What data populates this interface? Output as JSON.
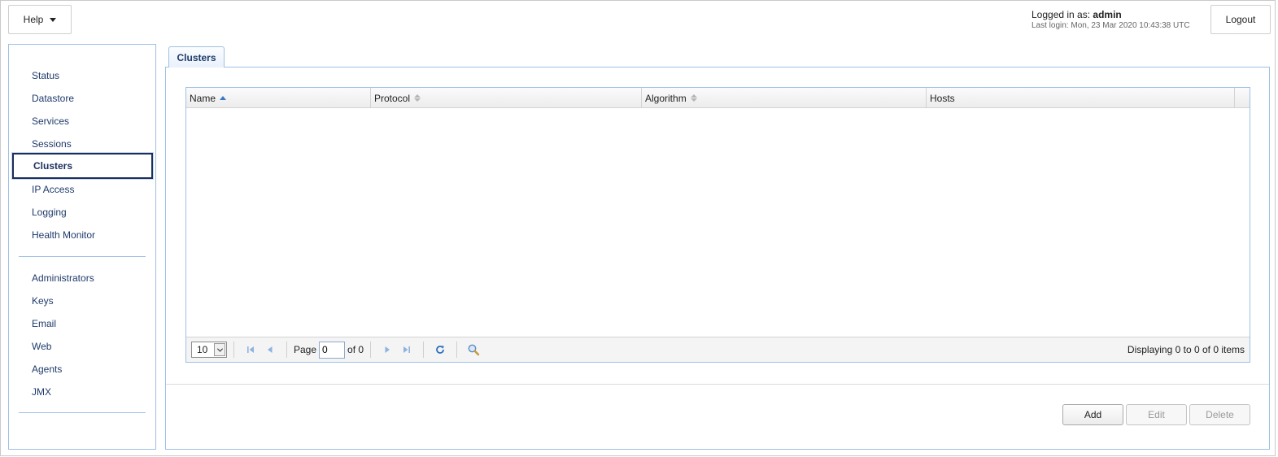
{
  "header": {
    "help_label": "Help",
    "logged_in_prefix": "Logged in as:",
    "username": "admin",
    "last_login": "Last login: Mon, 23 Mar 2020 10:43:38 UTC",
    "logout_label": "Logout"
  },
  "sidebar": {
    "group1": [
      {
        "label": "Status"
      },
      {
        "label": "Datastore"
      },
      {
        "label": "Services"
      },
      {
        "label": "Sessions"
      },
      {
        "label": "Clusters",
        "active": true
      },
      {
        "label": "IP Access"
      },
      {
        "label": "Logging"
      },
      {
        "label": "Health Monitor"
      }
    ],
    "group2": [
      {
        "label": "Administrators"
      },
      {
        "label": "Keys"
      },
      {
        "label": "Email"
      },
      {
        "label": "Web"
      },
      {
        "label": "Agents"
      },
      {
        "label": "JMX"
      }
    ]
  },
  "main": {
    "tab_label": "Clusters",
    "table": {
      "columns": [
        {
          "label": "Name",
          "sort": "asc"
        },
        {
          "label": "Protocol",
          "sort": "none"
        },
        {
          "label": "Algorithm",
          "sort": "none"
        },
        {
          "label": "Hosts",
          "sort": ""
        }
      ],
      "rows": []
    },
    "pager": {
      "page_size": "10",
      "page_label": "Page",
      "page_value": "0",
      "of_label": "of 0",
      "displaying": "Displaying 0 to 0 of 0 items"
    },
    "actions": {
      "add": "Add",
      "edit": "Edit",
      "delete": "Delete"
    }
  },
  "colors": {
    "accent_border": "#9ec0e6",
    "nav_text": "#1f3b6b",
    "active_border": "#1b2f5e",
    "pager_icon": "#8fb3e0"
  }
}
